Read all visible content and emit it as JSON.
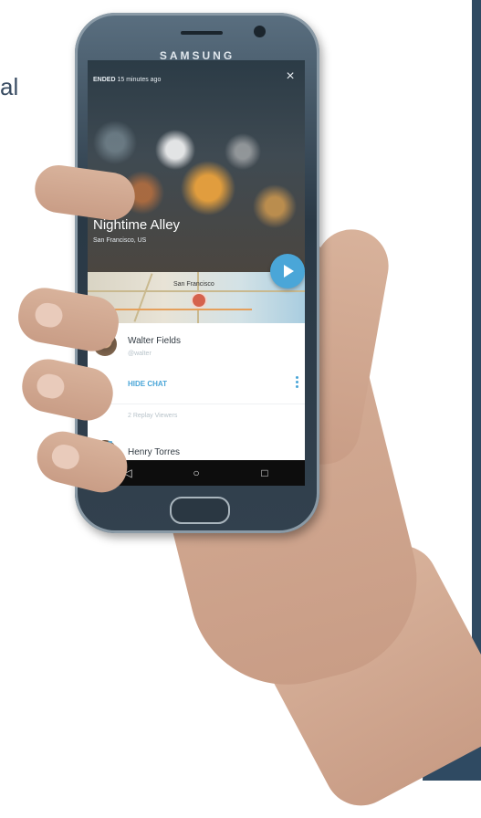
{
  "page": {
    "background_text": "al"
  },
  "device": {
    "brand": "SAMSUNG"
  },
  "stream": {
    "status_label": "ENDED",
    "time_ago": "15 minutes ago",
    "title": "Nightime Alley",
    "location": "San Francisco, US"
  },
  "map": {
    "city_label": "San Francisco"
  },
  "chat": {
    "viewers": [
      {
        "name": "Walter Fields",
        "handle": "@walter"
      },
      {
        "name": "Henry Torres"
      }
    ],
    "hide_chat_label": "HIDE CHAT",
    "replay_viewers_label": "2 Replay Viewers"
  },
  "icons": {
    "close": "close-icon",
    "play": "play-icon",
    "more": "more-vertical-icon",
    "heart": "heart-icon",
    "back": "back-triangle-icon",
    "home": "home-circle-icon",
    "recent": "recent-apps-square-icon"
  },
  "colors": {
    "accent": "#4aa6d8",
    "panel": "#2f4a62",
    "pin": "#d5624d"
  }
}
